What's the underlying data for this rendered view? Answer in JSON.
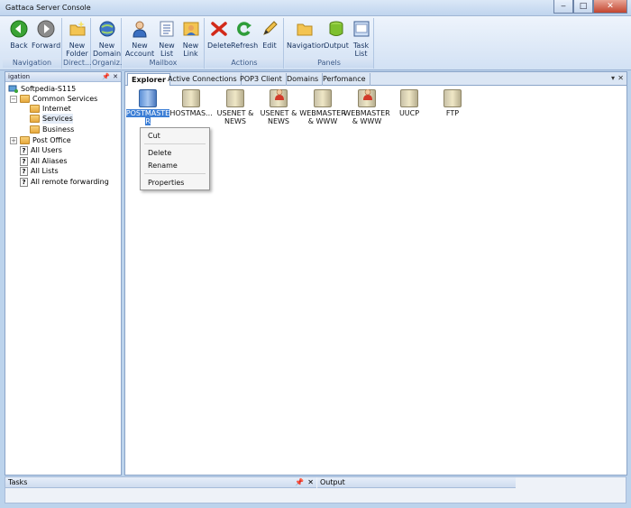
{
  "window": {
    "title": "Gattaca Server Console",
    "minimize": "‒",
    "maximize": "□",
    "close": "✕"
  },
  "ribbon": {
    "groups": {
      "navigation": "Navigation",
      "direct": "Direct...",
      "organiz": "Organiz...",
      "mailbox": "Mailbox",
      "actions": "Actions",
      "panels": "Panels"
    },
    "tools": {
      "back": "Back",
      "forward": "Forward",
      "new_folder": "New\nFolder",
      "new_domain": "New\nDomain",
      "new_account": "New\nAccount",
      "new_list": "New\nList",
      "new_link": "New\nLink",
      "delete": "Delete",
      "refresh": "Refresh",
      "edit": "Edit",
      "navigation": "Navigation",
      "output": "Output",
      "task_list": "Task\nList"
    }
  },
  "navigation_pane": {
    "header": "igation",
    "pin": "📌",
    "close": "✕",
    "tree": {
      "root": "Softpedia-S115",
      "common_services": "Common Services",
      "internet": "Internet",
      "services": "Services",
      "business": "Business",
      "post_office": "Post Office",
      "all_users": "All Users",
      "all_aliases": "All Aliases",
      "all_lists": "All Lists",
      "all_remote": "All remote forwarding"
    }
  },
  "tabs": {
    "explorer": "Explorer",
    "active_connections": "Active Connections",
    "pop3": "POP3 Client",
    "domains": "Domains",
    "performance": "Perfomance",
    "dropdown": "▾",
    "close": "✕"
  },
  "items": {
    "postmaster": "POSTMASTE\nR",
    "hostmaster": "HOSTMAS...",
    "usenet1": "USENET &\nNEWS",
    "usenet2": "USENET &\nNEWS",
    "webmaster1": "WEBMASTER\n& WWW",
    "webmaster2": "WEBMASTER\n& WWW",
    "uucp": "UUCP",
    "ftp": "FTP"
  },
  "context_menu": {
    "cut": "Cut",
    "delete": "Delete",
    "rename": "Rename",
    "properties": "Properties"
  },
  "bottom": {
    "tasks": "Tasks",
    "output": "Output",
    "pin": "📌",
    "close": "✕"
  }
}
